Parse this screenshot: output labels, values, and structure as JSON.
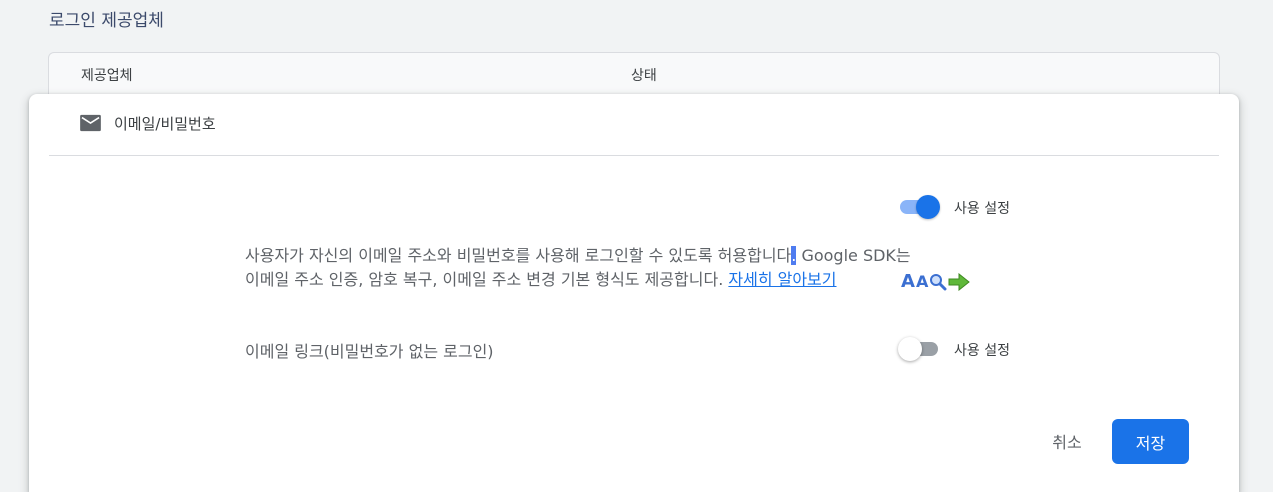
{
  "section_title": "로그인 제공업체",
  "table": {
    "headers": [
      "제공업체",
      "상태"
    ]
  },
  "panel": {
    "provider_name": "이메일/비밀번호",
    "provider_icon": "mail-icon",
    "enable_toggle": {
      "label": "사용 설정",
      "state": "on"
    },
    "description": {
      "text_part1": "사용자가 자신의 이메일 주소와 비밀번호를 사용해 로그인할 수 있도록 허용합니다",
      "highlighted": ".",
      "text_part2": " Google SDK는",
      "text_line2": "이메일 주소 인증, 암호 복구, 이메일 주소 변경 기본 형식도 제공합니다. ",
      "link_text": "자세히 알아보기"
    },
    "email_link": {
      "label": "이메일 링크(비밀번호가 없는 로그인)",
      "toggle": {
        "label": "사용 설정",
        "state": "off"
      }
    },
    "buttons": {
      "cancel": "취소",
      "save": "저장"
    }
  },
  "colors": {
    "primary": "#1a73e8",
    "toggle_track_on": "#8ab4f8"
  }
}
